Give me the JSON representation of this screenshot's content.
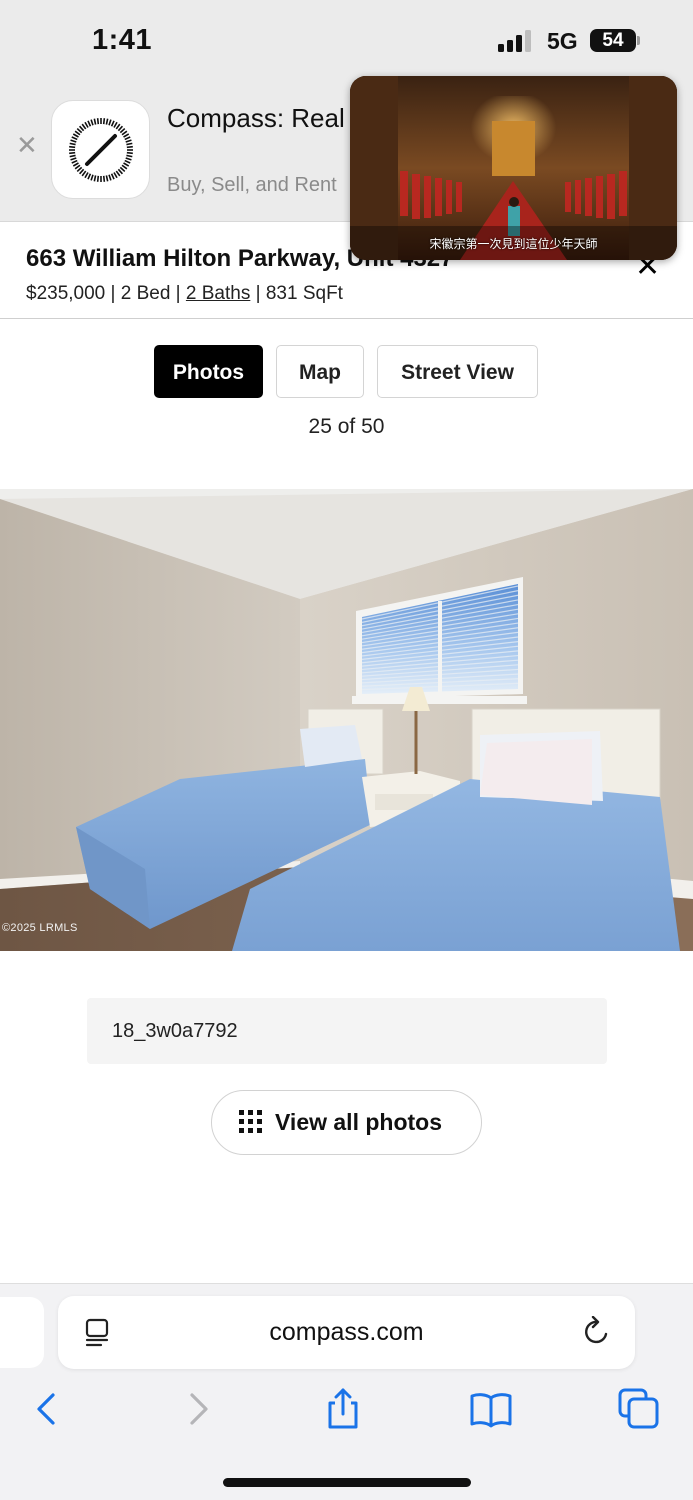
{
  "status_bar": {
    "time": "1:41",
    "network": "5G",
    "battery": "54"
  },
  "app_banner": {
    "title": "Compass: Real & Homes",
    "subtitle": "Buy, Sell, and Rent",
    "close_icon": "close-icon",
    "app_icon": "compass-logo-icon"
  },
  "pip_video": {
    "caption": "宋徽宗第一次見到這位少年天師"
  },
  "listing": {
    "address": "663 William Hilton Parkway, Unit 4327",
    "price": "$235,000",
    "beds": "2 Bed",
    "baths": "2 Baths",
    "sqft": "831 SqFt",
    "separator": " | "
  },
  "tabs": [
    {
      "label": "Photos",
      "active": true
    },
    {
      "label": "Map",
      "active": false
    },
    {
      "label": "Street View",
      "active": false
    }
  ],
  "gallery": {
    "counter": "25 of 50",
    "copyright": "©2025 LRMLS",
    "photo_caption": "18_3w0a7792",
    "view_all_label": "View all photos"
  },
  "browser": {
    "url": "compass.com",
    "toolbar_icons": [
      "back-icon",
      "forward-icon",
      "share-icon",
      "bookmarks-icon",
      "tabs-icon"
    ],
    "accent_color": "#1a73e8"
  }
}
